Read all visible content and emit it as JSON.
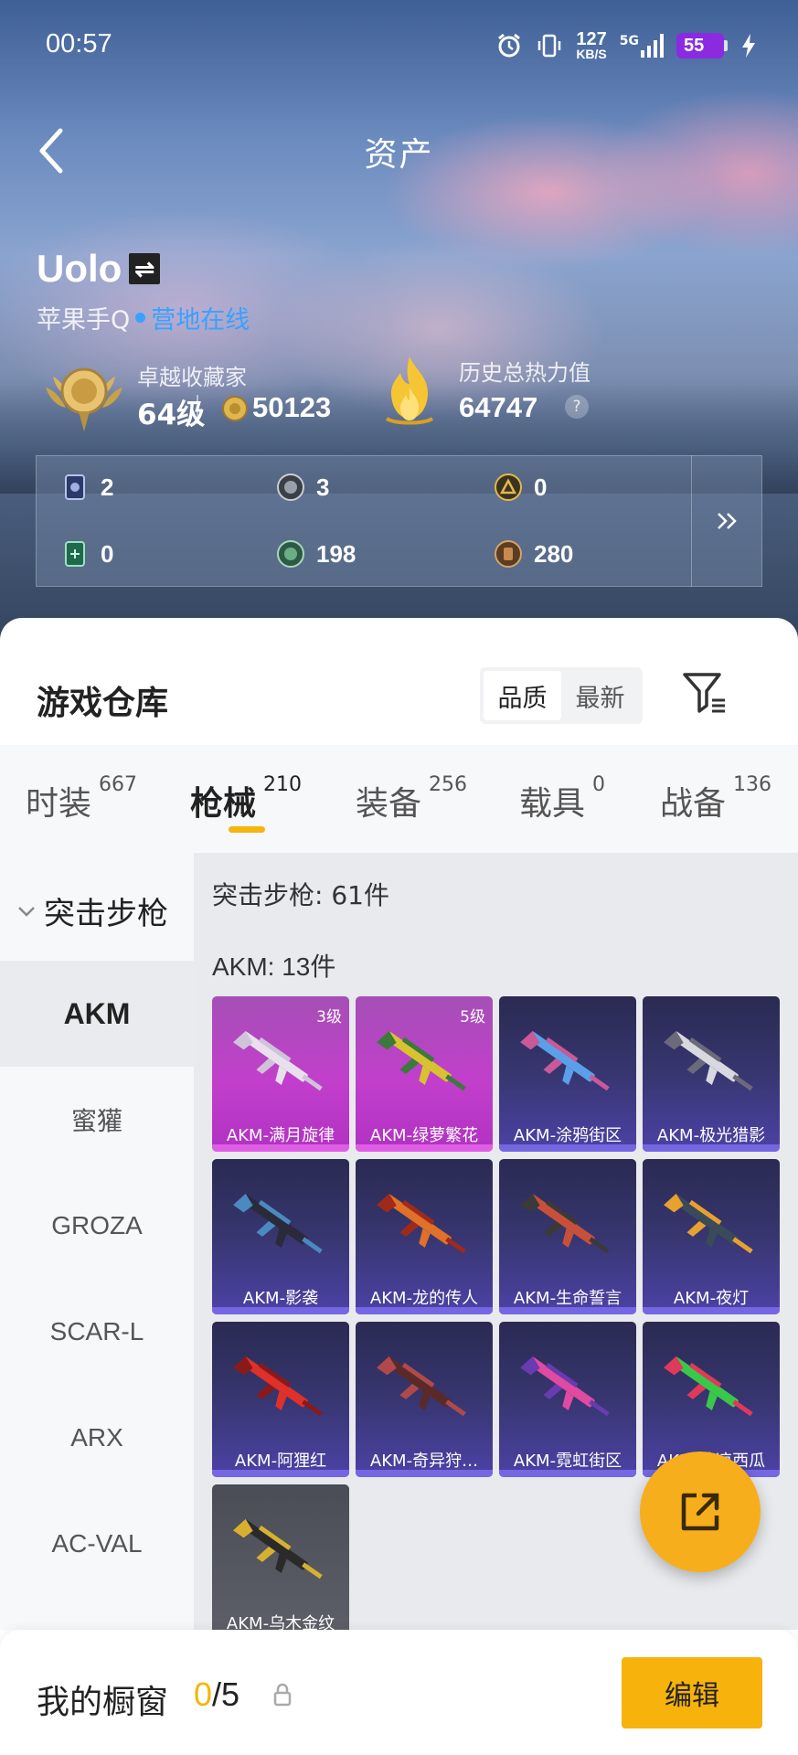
{
  "status_bar": {
    "time": "00:57",
    "net_speed": "127",
    "net_unit": "KB/S",
    "net_type": "5G",
    "battery": "55"
  },
  "header": {
    "title": "资产"
  },
  "player": {
    "name": "Uolo",
    "platform": "苹果手Q",
    "online_status": "营地在线",
    "rank_label": "卓越收藏家",
    "rank_level": "64级",
    "coins": "50123",
    "heat_label": "历史总热力值",
    "heat_value": "64747",
    "help": "?"
  },
  "stats": [
    {
      "icon": "card-pack-icon",
      "value": "2"
    },
    {
      "icon": "silver-medal-icon",
      "value": "3"
    },
    {
      "icon": "gold-emblem-icon",
      "value": "0"
    },
    {
      "icon": "green-card-icon",
      "value": "0"
    },
    {
      "icon": "green-coin-icon",
      "value": "198"
    },
    {
      "icon": "bronze-coin-icon",
      "value": "280"
    }
  ],
  "warehouse": {
    "title": "游戏仓库",
    "sort_options": [
      "品质",
      "最新"
    ],
    "sort_selected": "品质"
  },
  "tabs": [
    {
      "label": "时装",
      "count": "667"
    },
    {
      "label": "枪械",
      "count": "210",
      "active": true
    },
    {
      "label": "装备",
      "count": "256"
    },
    {
      "label": "载具",
      "count": "0"
    },
    {
      "label": "战备",
      "count": "136"
    }
  ],
  "categories": {
    "group": "突击步枪",
    "items": [
      "AKM",
      "蜜獾",
      "GROZA",
      "SCAR-L",
      "ARX",
      "AC-VAL"
    ],
    "selected": "AKM"
  },
  "content": {
    "group_title": "突击步枪: 61件",
    "sub_title": "AKM: 13件",
    "cards": [
      {
        "name": "AKM-满月旋律",
        "grade": "3级",
        "tier": "pink"
      },
      {
        "name": "AKM-绿萝繁花",
        "grade": "5级",
        "tier": "pink"
      },
      {
        "name": "AKM-涂鸦街区",
        "grade": "",
        "tier": "purple"
      },
      {
        "name": "AKM-极光猎影",
        "grade": "",
        "tier": "purple"
      },
      {
        "name": "AKM-影袭",
        "grade": "",
        "tier": "purple"
      },
      {
        "name": "AKM-龙的传人",
        "grade": "",
        "tier": "purple"
      },
      {
        "name": "AKM-生命誓言",
        "grade": "",
        "tier": "purple"
      },
      {
        "name": "AKM-夜灯",
        "grade": "",
        "tier": "purple"
      },
      {
        "name": "AKM-阿狸红",
        "grade": "",
        "tier": "purple"
      },
      {
        "name": "AKM-奇异狩…",
        "grade": "",
        "tier": "purple"
      },
      {
        "name": "AKM-霓虹街区",
        "grade": "",
        "tier": "purple"
      },
      {
        "name": "AKM-冰凉西瓜",
        "grade": "",
        "tier": "purple"
      },
      {
        "name": "AKM-乌木金纹",
        "grade": "",
        "tier": "gray"
      }
    ]
  },
  "showcase": {
    "label": "我的橱窗",
    "current": "0",
    "total": "/5",
    "edit_label": "编辑"
  },
  "colors": {
    "accent": "#f5b50a",
    "online": "#3aa0ff",
    "pink_tier": "#c23fcc",
    "purple_tier": "#373670"
  }
}
